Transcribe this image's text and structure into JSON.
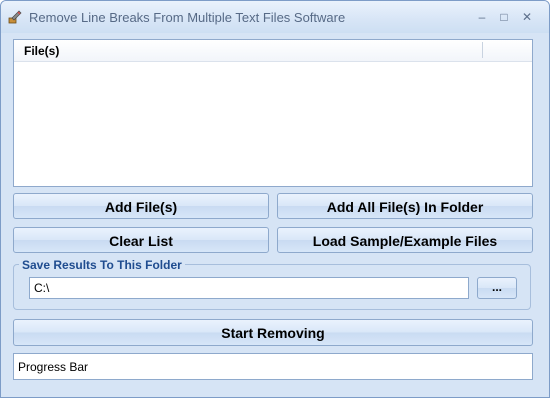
{
  "window": {
    "title": "Remove Line Breaks From Multiple Text Files Software",
    "icon": "brush-icon",
    "controls": {
      "minimize": "–",
      "maximize": "□",
      "close": "✕"
    }
  },
  "file_list": {
    "columns": [
      "File(s)"
    ],
    "rows": []
  },
  "buttons": {
    "add_files": "Add File(s)",
    "add_folder": "Add All File(s) In Folder",
    "clear_list": "Clear List",
    "load_samples": "Load Sample/Example Files",
    "start": "Start Removing"
  },
  "output": {
    "group_label": "Save Results To This Folder",
    "folder_value": "C:\\",
    "browse_label": "..."
  },
  "progress": {
    "label": "Progress Bar",
    "value": 0
  },
  "colors": {
    "window_bg": "#d6e4f5",
    "accent": "#1f4c8f"
  }
}
